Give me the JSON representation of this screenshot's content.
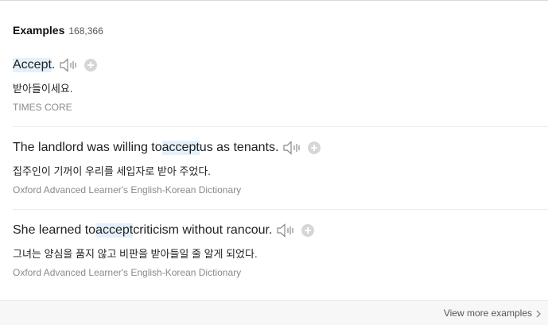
{
  "header": {
    "title": "Examples",
    "count": "168,366"
  },
  "examples": [
    {
      "before": "",
      "highlight": "Accept",
      "after": ".",
      "translation": "받아들이세요.",
      "source": "TIMES CORE"
    },
    {
      "before": "The landlord was willing to ",
      "highlight": "accept",
      "after": " us as tenants.",
      "translation": "집주인이 기꺼이 우리를 세입자로 받아 주었다.",
      "source": "Oxford Advanced Learner's English-Korean Dictionary"
    },
    {
      "before": "She learned to ",
      "highlight": "accept",
      "after": " criticism without rancour.",
      "translation": "그녀는 양심을 품지 않고 비판을 받아들일 줄 알게 되었다.",
      "source": "Oxford Advanced Learner's English-Korean Dictionary"
    }
  ],
  "footer": {
    "view_more": "View more examples"
  },
  "icons": {
    "speaker": "speaker-icon",
    "add": "plus-circle-icon",
    "chevron": "chevron-right-icon"
  },
  "colors": {
    "highlight": "#e4f1fc",
    "source_text": "#8a8a8a",
    "add_button": "#d6d6d6"
  }
}
